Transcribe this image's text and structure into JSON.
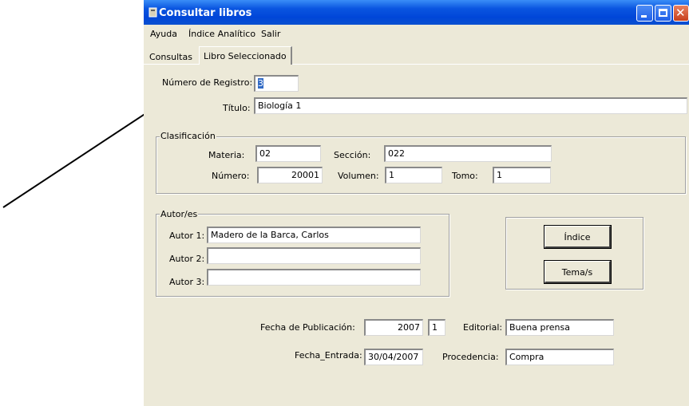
{
  "window": {
    "title": "Consultar libros"
  },
  "menu": [
    "Ayuda",
    "Índice Analítico",
    "Salir"
  ],
  "tabs": [
    {
      "label": "Consultas",
      "active": false
    },
    {
      "label": "Libro Seleccionado",
      "active": true
    }
  ],
  "registro": {
    "label": "Número de Registro:",
    "value": "3"
  },
  "titulo": {
    "label": "Título:",
    "value": "Biología 1"
  },
  "clasificacion": {
    "title": "Clasificación",
    "materia": {
      "label": "Materia:",
      "value": "02"
    },
    "seccion": {
      "label": "Sección:",
      "value": "022"
    },
    "numero": {
      "label": "Número:",
      "value": "20001"
    },
    "volumen": {
      "label": "Volumen:",
      "value": "1"
    },
    "tomo": {
      "label": "Tomo:",
      "value": "1"
    }
  },
  "autores": {
    "title": "Autor/es",
    "items": [
      {
        "label": "Autor 1:",
        "value": "Madero de la Barca, Carlos"
      },
      {
        "label": "Autor 2:",
        "value": ""
      },
      {
        "label": "Autor 3:",
        "value": ""
      }
    ]
  },
  "buttons": {
    "indice": "Índice",
    "temas": "Tema/s"
  },
  "publicacion": {
    "label": "Fecha de Publicación:",
    "year": "2007",
    "extra": "1"
  },
  "editorial": {
    "label": "Editorial:",
    "value": "Buena prensa"
  },
  "entrada": {
    "label": "Fecha_Entrada:",
    "value": "30/04/2007"
  },
  "procedencia": {
    "label": "Procedencia:",
    "value": "Compra"
  },
  "colors": {
    "titlebar": "#0a55e0",
    "window_bg": "#ece9d8",
    "selection": "#316ac5",
    "close_button": "#c8401c"
  }
}
